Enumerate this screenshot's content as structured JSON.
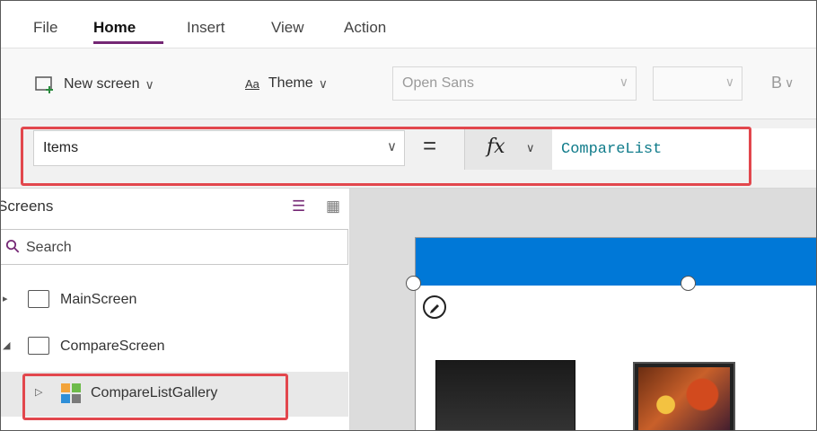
{
  "menu": {
    "items": [
      "File",
      "Home",
      "Insert",
      "View",
      "Action"
    ],
    "active": "Home",
    "accent_color": "#742774"
  },
  "toolbar": {
    "new_screen_label": "New screen",
    "theme_label": "Theme",
    "font_name": "Open Sans",
    "font_size": "",
    "bold_label": "B",
    "chevron": "∨"
  },
  "formula": {
    "property": "Items",
    "equals": "=",
    "fx_label": "fx",
    "expression": "CompareList",
    "highlight_color": "#e2474d"
  },
  "tree": {
    "title": "Screens",
    "search_placeholder": "Search",
    "items": [
      {
        "label": "MainScreen",
        "type": "screen"
      },
      {
        "label": "CompareScreen",
        "type": "screen"
      },
      {
        "label": "CompareListGallery",
        "type": "gallery",
        "selected": true
      }
    ]
  },
  "canvas": {
    "header_color": "#0078d7"
  }
}
